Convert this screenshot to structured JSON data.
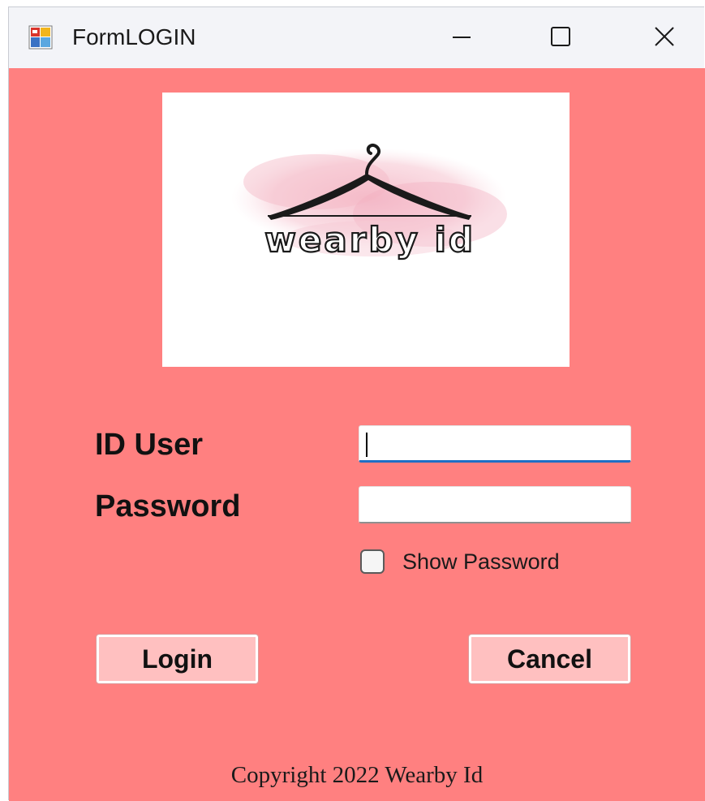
{
  "window": {
    "title": "FormLOGIN",
    "icon": "winforms-app-icon",
    "controls": {
      "minimize_icon": "minimize-icon",
      "maximize_icon": "maximize-icon",
      "close_icon": "close-icon"
    }
  },
  "colors": {
    "form_background": "#ff8080",
    "button_background": "#ffc0c0",
    "focus_accent": "#1f6fc5",
    "titlebar": "#f3f4f8"
  },
  "logo": {
    "brand_text": "wearby id",
    "icon": "hanger-icon"
  },
  "form": {
    "id_user_label": "ID User",
    "id_user_value": "",
    "password_label": "Password",
    "password_value": "",
    "show_password_label": "Show Password",
    "show_password_checked": false
  },
  "buttons": {
    "login_label": "Login",
    "cancel_label": "Cancel"
  },
  "footer": {
    "copyright": "Copyright 2022 Wearby Id"
  }
}
